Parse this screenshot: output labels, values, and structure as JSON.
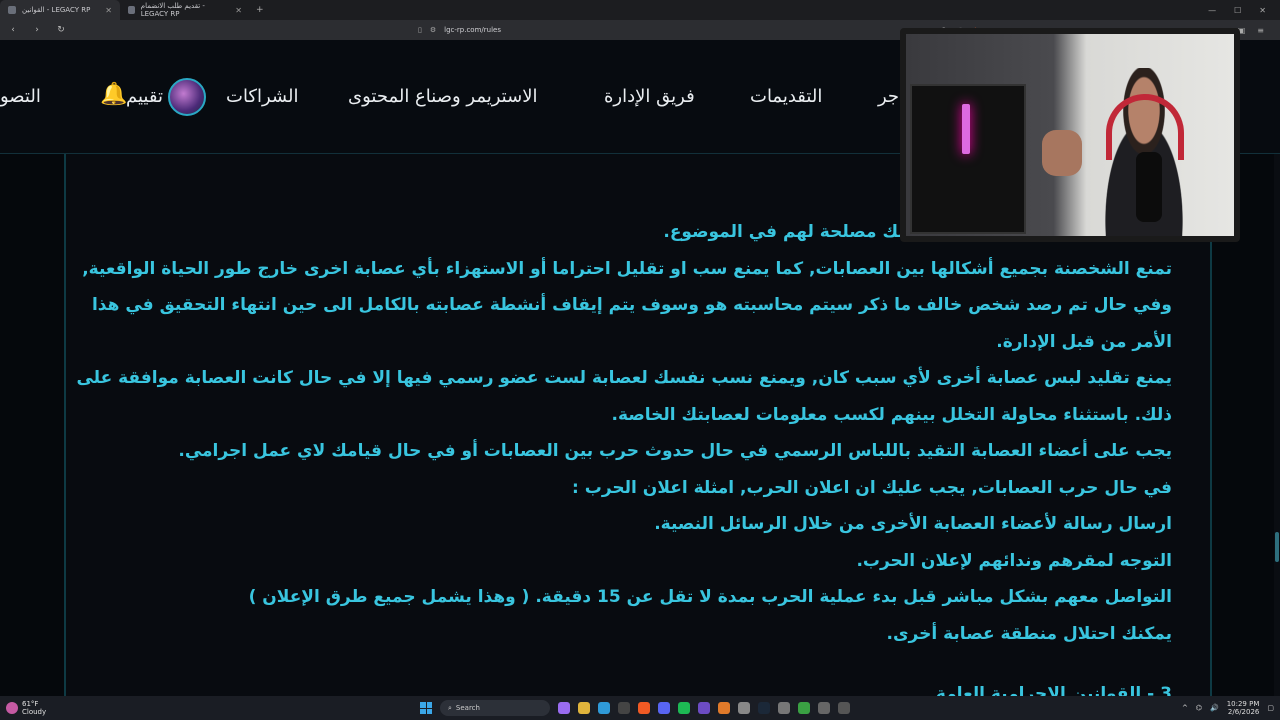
{
  "browser": {
    "tabs": [
      {
        "label": "القوانين - LEGACY RP",
        "active": true
      },
      {
        "label": "تقديم طلب الانضمام - LEGACY RP",
        "active": false
      }
    ],
    "new_tab": "+",
    "url": "lgc-rp.com/rules"
  },
  "nav": {
    "items": [
      {
        "label": "جر"
      },
      {
        "label": "التقديمات"
      },
      {
        "label": "فريق الإدارة"
      },
      {
        "label": "الاستريمر وصناع المحتوى"
      },
      {
        "label": "الشراكات"
      },
      {
        "label": "تقييم"
      },
      {
        "label": "التصو"
      }
    ]
  },
  "content": {
    "lines": [
      "عصابة أخرى إلا في حال كان هنالك مصلحة لهم في الموضوع.",
      "تمنع الشخصنة بجميع أشكالها بين العصابات, كما يمنع سب او تقليل احتراما أو الاستهزاء بأي عصابة اخرى خارج طور الحياة الواقعية,",
      "وفي حال تم رصد شخص خالف ما ذكر سيتم محاسبته هو وسوف يتم إيقاف أنشطة عصابته بالكامل الى حين انتهاء التحقيق في هذا",
      "الأمر من قبل الإدارة.",
      "يمنع تقليد لبس عصابة أخرى لأي سبب كان, ويمنع نسب نفسك لعصابة لست عضو رسمي فيها إلا في حال كانت العصابة موافقة على",
      "ذلك. باستثناء محاولة التخلل بينهم لكسب معلومات لعصابتك الخاصة.",
      "يجب على أعضاء العصابة التقيد باللباس الرسمي في حال حدوث حرب بين العصابات أو في حال قيامك لاي عمل اجرامي.",
      "في حال حرب العصابات, يجب عليك ان اعلان الحرب, امثلة اعلان الحرب :",
      "ارسال رسالة لأعضاء العصابة الأخرى من خلال الرسائل النصية.",
      "التوجه لمقرهم وندائهم لإعلان الحرب.",
      "التواصل معهم بشكل مباشر قبل بدء عملية الحرب بمدة لا تقل عن 15 دقيقة. ( وهذا يشمل جميع طرق الإعلان )",
      "يمكنك احتلال منطقة عصابة أخرى."
    ],
    "next_section": "3 - القوانين الاجرامية العامة"
  },
  "taskbar": {
    "weather_temp": "61°F",
    "weather_text": "Cloudy",
    "search_placeholder": "Search",
    "time": "10:29 PM",
    "date": "2/6/2026"
  },
  "colors": {
    "accent": "#39c5df",
    "background": "#05080c"
  }
}
